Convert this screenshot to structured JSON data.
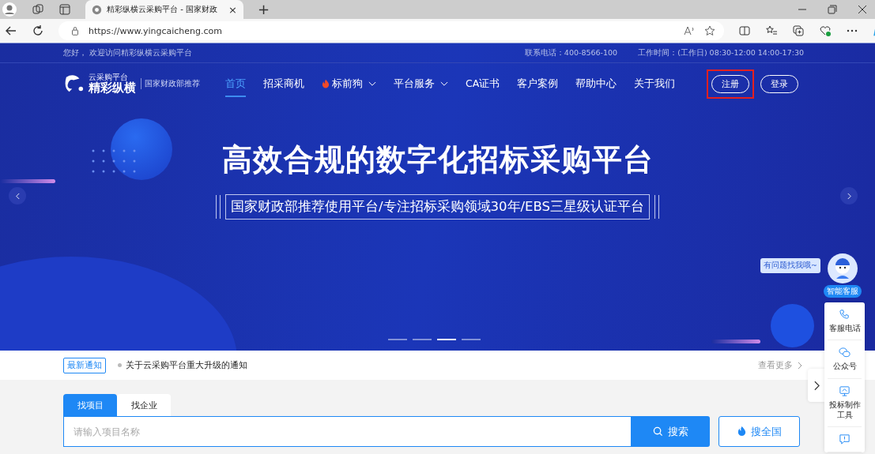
{
  "browser": {
    "tab_title": "精彩纵横云采购平台 - 国家财政",
    "tab_close": "×",
    "new_tab": "+",
    "url": "https://www.yingcaicheng.com"
  },
  "topbar": {
    "greeting": "您好， 欢迎访问精彩纵横云采购平台",
    "phone": "联系电话：400-8566-100",
    "hours": "工作时间：(工作日) 08:30-12:00 14:00-17:30"
  },
  "logo": {
    "small": "云采购平台",
    "name": "精彩纵横",
    "tagline": "国家财政部推荐"
  },
  "nav": [
    {
      "label": "首页",
      "selected": true,
      "hot": false,
      "dropdown": false
    },
    {
      "label": "招采商机",
      "selected": false,
      "hot": false,
      "dropdown": false
    },
    {
      "label": "标前狗",
      "selected": false,
      "hot": true,
      "dropdown": true
    },
    {
      "label": "平台服务",
      "selected": false,
      "hot": false,
      "dropdown": true
    },
    {
      "label": "CA证书",
      "selected": false,
      "hot": false,
      "dropdown": false
    },
    {
      "label": "客户案例",
      "selected": false,
      "hot": false,
      "dropdown": false
    },
    {
      "label": "帮助中心",
      "selected": false,
      "hot": false,
      "dropdown": false
    },
    {
      "label": "关于我们",
      "selected": false,
      "hot": false,
      "dropdown": false
    }
  ],
  "auth": [
    {
      "label": "注册",
      "highlighted": true
    },
    {
      "label": "登录",
      "highlighted": false
    }
  ],
  "banner": {
    "headline": "高效合规的数字化招标采购平台",
    "subtitle": "国家财政部推荐使用平台/专注招标采购领域30年/EBS三星级认证平台",
    "slides": [
      {
        "selected": false
      },
      {
        "selected": false
      },
      {
        "selected": true
      },
      {
        "selected": false
      }
    ]
  },
  "notice": {
    "badge": "最新通知",
    "text": "关于云采购平台重大升级的通知",
    "more": "查看更多"
  },
  "search": {
    "tabs": [
      {
        "label": "找项目",
        "selected": true
      },
      {
        "label": "找企业",
        "selected": false
      }
    ],
    "placeholder": "请输入项目名称",
    "button": "搜索",
    "national_button": "搜全国"
  },
  "side_panel": {
    "bubble": "有问题找我哦~",
    "assistant": "智能客服",
    "items": [
      {
        "kind": "phone",
        "label": "客服电话"
      },
      {
        "kind": "wechat",
        "label": "公众号"
      },
      {
        "kind": "monitor",
        "label": "投标制作工具"
      },
      {
        "kind": "alert"
      }
    ]
  }
}
